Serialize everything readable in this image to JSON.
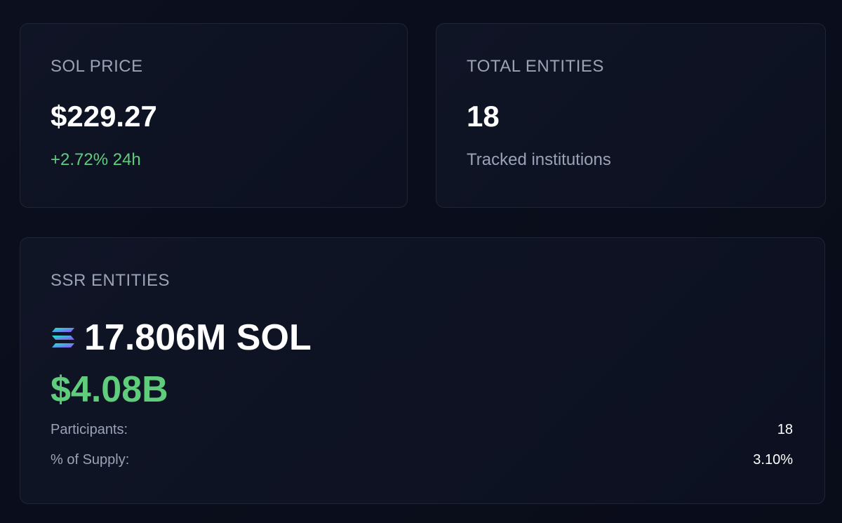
{
  "sol_price": {
    "label": "SOL PRICE",
    "value": "$229.27",
    "change": "+2.72% 24h"
  },
  "total_entities": {
    "label": "TOTAL ENTITIES",
    "value": "18",
    "subtitle": "Tracked institutions"
  },
  "ssr_entities": {
    "label": "SSR ENTITIES",
    "icon": "solana-logo-icon",
    "sol_amount": "17.806M SOL",
    "usd_amount": "$4.08B",
    "rows": [
      {
        "key": "Participants:",
        "value": "18"
      },
      {
        "key": "% of Supply:",
        "value": "3.10%"
      }
    ]
  },
  "colors": {
    "background": "#0a0d1a",
    "card_border": "#1f2535",
    "positive": "#5fcd7c",
    "muted_text": "#9aa3b6"
  }
}
